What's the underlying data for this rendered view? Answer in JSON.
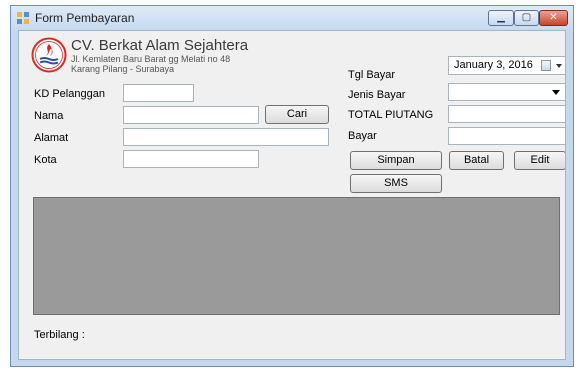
{
  "window": {
    "title": "Form Pembayaran"
  },
  "company": {
    "name": "CV. Berkat Alam Sejahtera",
    "address_line1": "Jl. Kemlaten Baru Barat gg Melati no 48",
    "address_line2": "Karang Pilang - Surabaya"
  },
  "form": {
    "kd_pelanggan_label": "KD Pelanggan",
    "kd_pelanggan_value": "",
    "nama_label": "Nama",
    "nama_value": "",
    "cari_label": "Cari",
    "alamat_label": "Alamat",
    "alamat_value": "",
    "kota_label": "Kota",
    "kota_value": "",
    "tgl_bayar_label": "Tgl Bayar",
    "tgl_bayar_value": "January    3, 2016",
    "jenis_bayar_label": "Jenis Bayar",
    "jenis_bayar_value": "",
    "total_piutang_label": "TOTAL PIUTANG",
    "total_piutang_value": "",
    "bayar_label": "Bayar",
    "bayar_value": ""
  },
  "buttons": {
    "simpan": "Simpan",
    "batal": "Batal",
    "edit": "Edit",
    "sms": "SMS"
  },
  "footer": {
    "terbilang_label": "Terbilang :"
  },
  "icons": {
    "title": "form-icon",
    "logo": "company-logo-icon",
    "calendar": "calendar-icon",
    "dropdown": "chevron-down-icon"
  },
  "colors": {
    "logo_red": "#d62a22",
    "logo_blue": "#2a4fa5",
    "grid_background": "#9a9a9a"
  }
}
